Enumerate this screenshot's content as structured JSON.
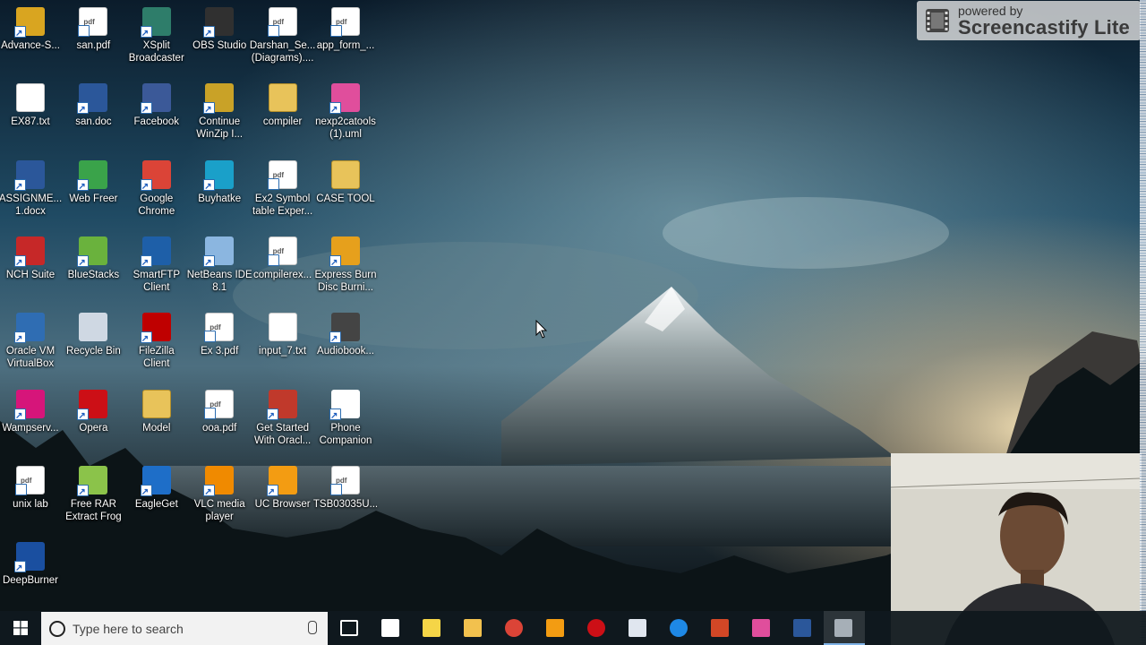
{
  "desktop": {
    "icons": [
      {
        "label": "Advance-S...",
        "kind": "app-icon",
        "color": "#d9a520"
      },
      {
        "label": "san.pdf",
        "kind": "pdf-file-icon",
        "color": "#ffffff"
      },
      {
        "label": "XSplit\nBroadcaster",
        "kind": "xsplit-icon",
        "color": "#2e7d6a"
      },
      {
        "label": "OBS Studio",
        "kind": "obs-icon",
        "color": "#303030"
      },
      {
        "label": "Darshan_Se...\n(Diagrams)....",
        "kind": "pdf-file-icon",
        "color": "#ffffff"
      },
      {
        "label": "app_form_...",
        "kind": "pdf-file-icon",
        "color": "#ffffff"
      },
      {
        "label": "EX87.txt",
        "kind": "text-file-icon",
        "color": "#ffffff"
      },
      {
        "label": "san.doc",
        "kind": "word-doc-icon",
        "color": "#2b579a"
      },
      {
        "label": "Facebook",
        "kind": "facebook-icon",
        "color": "#3b5998"
      },
      {
        "label": "Continue\nWinZip I...",
        "kind": "winzip-icon",
        "color": "#c9a227"
      },
      {
        "label": "compiler",
        "kind": "folder-icon",
        "color": "#e8c35a"
      },
      {
        "label": "nexp2catools\n(1).uml",
        "kind": "star-uml-icon",
        "color": "#e04e9c"
      },
      {
        "label": "ASSIGNME...\n1.docx",
        "kind": "word-doc-icon",
        "color": "#2b579a"
      },
      {
        "label": "Web Freer",
        "kind": "globe-icon",
        "color": "#3aa34a"
      },
      {
        "label": "Google\nChrome",
        "kind": "chrome-icon",
        "color": "#db4437"
      },
      {
        "label": "Buyhatke",
        "kind": "buyhatke-icon",
        "color": "#1aa0c9"
      },
      {
        "label": "Ex2 Symbol\ntable Exper...",
        "kind": "pdf-file-icon",
        "color": "#ffffff"
      },
      {
        "label": "CASE TOOL",
        "kind": "folder-icon",
        "color": "#e8c35a"
      },
      {
        "label": "NCH Suite",
        "kind": "nch-icon",
        "color": "#c62828"
      },
      {
        "label": "BlueStacks",
        "kind": "bluestacks-icon",
        "color": "#6ab23d"
      },
      {
        "label": "SmartFTP\nClient",
        "kind": "smartftp-icon",
        "color": "#1e5fa8"
      },
      {
        "label": "NetBeans IDE\n8.1",
        "kind": "netbeans-icon",
        "color": "#8bb6e0"
      },
      {
        "label": "compilerex...",
        "kind": "pdf-file-icon",
        "color": "#ffffff"
      },
      {
        "label": "Express Burn\nDisc Burni...",
        "kind": "expressburn-icon",
        "color": "#e6a01c"
      },
      {
        "label": "Oracle VM\nVirtualBox",
        "kind": "virtualbox-icon",
        "color": "#2f6db3"
      },
      {
        "label": "Recycle Bin",
        "kind": "recycle-bin-icon",
        "color": "#cfd8e3"
      },
      {
        "label": "FileZilla\nClient",
        "kind": "filezilla-icon",
        "color": "#bf0000"
      },
      {
        "label": "Ex 3.pdf",
        "kind": "pdf-file-icon",
        "color": "#ffffff"
      },
      {
        "label": "input_7.txt",
        "kind": "text-file-icon",
        "color": "#ffffff"
      },
      {
        "label": "Audiobook...",
        "kind": "audiobook-icon",
        "color": "#444444"
      },
      {
        "label": "Wampserv...",
        "kind": "wampserver-icon",
        "color": "#d6157a"
      },
      {
        "label": "Opera",
        "kind": "opera-icon",
        "color": "#cc0f16"
      },
      {
        "label": "Model",
        "kind": "folder-icon",
        "color": "#e8c35a"
      },
      {
        "label": "ooa.pdf",
        "kind": "pdf-file-icon",
        "color": "#ffffff"
      },
      {
        "label": "Get Started\nWith Oracl...",
        "kind": "oracle-db-icon",
        "color": "#c0392b"
      },
      {
        "label": "Phone\nCompanion",
        "kind": "phone-companion-icon",
        "color": "#ffffff"
      },
      {
        "label": "unix lab",
        "kind": "pdf-file-icon",
        "color": "#f3d36b"
      },
      {
        "label": "Free RAR\nExtract Frog",
        "kind": "rar-frog-icon",
        "color": "#8bc34a"
      },
      {
        "label": "EagleGet",
        "kind": "eagleget-icon",
        "color": "#1e6ec8"
      },
      {
        "label": "VLC media\nplayer",
        "kind": "vlc-icon",
        "color": "#f08a00"
      },
      {
        "label": "UC Browser",
        "kind": "uc-browser-icon",
        "color": "#f39c12"
      },
      {
        "label": "TSB03035U...",
        "kind": "pdf-file-icon",
        "color": "#ffffff"
      },
      {
        "label": "DeepBurner",
        "kind": "deepburner-icon",
        "color": "#1a4fa0"
      }
    ]
  },
  "overlay": {
    "powered_by": "powered by",
    "brand": "Screencastify Lite"
  },
  "taskbar": {
    "search_placeholder": "Type here to search",
    "pinned": [
      {
        "name": "task-view-icon",
        "color": "#ffffff"
      },
      {
        "name": "store-icon",
        "color": "#ffffff"
      },
      {
        "name": "sticky-notes-icon",
        "color": "#f5d547"
      },
      {
        "name": "file-explorer-icon",
        "color": "#f2c14e"
      },
      {
        "name": "chrome-icon",
        "color": "#db4437"
      },
      {
        "name": "uc-browser-icon",
        "color": "#f39c12"
      },
      {
        "name": "opera-icon",
        "color": "#cc0f16"
      },
      {
        "name": "file-manager-icon",
        "color": "#e0e6ef"
      },
      {
        "name": "edge-icon",
        "color": "#1e88e5"
      },
      {
        "name": "powerpoint-icon",
        "color": "#d24726"
      },
      {
        "name": "star-uml-icon",
        "color": "#e04e9c"
      },
      {
        "name": "word-icon",
        "color": "#2b579a"
      },
      {
        "name": "screencastify-icon",
        "color": "#9aa4ad"
      }
    ]
  }
}
